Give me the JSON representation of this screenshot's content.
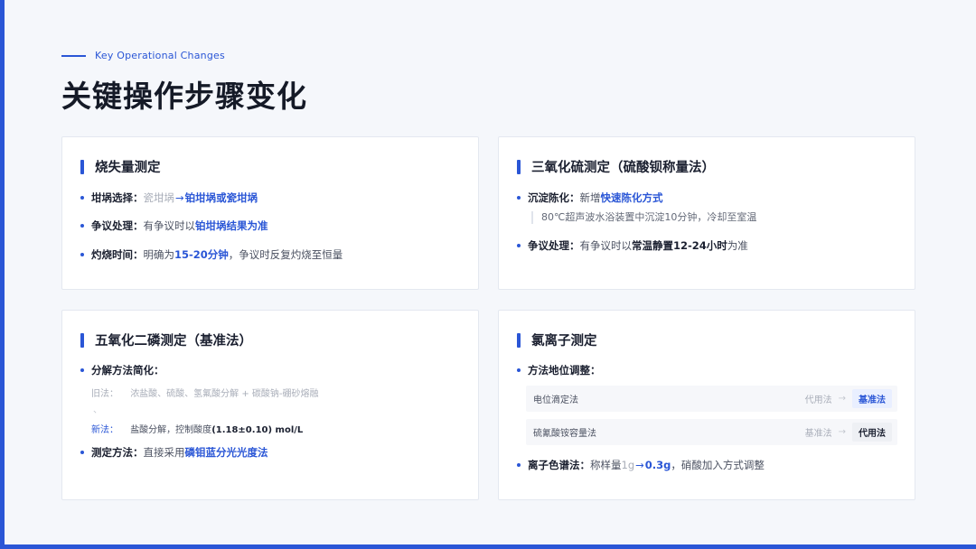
{
  "header": {
    "eyebrow": "Key Operational Changes",
    "title": "关键操作步骤变化"
  },
  "cards": [
    {
      "title": "烧失量测定",
      "items": [
        {
          "label": "坩埚选择：",
          "old": "瓷坩埚",
          "arrow": "→",
          "new": "铂坩埚或瓷坩埚"
        },
        {
          "label": "争议处理：",
          "text": "有争议时以",
          "highlight": "铂坩埚结果为准"
        },
        {
          "label": "灼烧时间：",
          "text": "明确为",
          "highlight": "15-20分钟",
          "tail": "，争议时反复灼烧至恒量"
        }
      ]
    },
    {
      "title": "三氧化硫测定（硫酸钡称量法）",
      "items": [
        {
          "label": "沉淀陈化：",
          "text": "新增 ",
          "highlight": "快速陈化方式",
          "note": "80℃超声波水浴装置中沉淀10分钟，冷却至室温"
        },
        {
          "label": "争议处理：",
          "text": "有争议时以",
          "strong": "常温静置12-24小时",
          "tail": "为准"
        }
      ]
    },
    {
      "title": "五氧化二磷测定（基准法）",
      "items": [
        {
          "label": "分解方法简化："
        },
        {
          "label": "测定方法：",
          "text": "直接采用",
          "highlight": "磷钼蓝分光光度法"
        }
      ],
      "old_method": {
        "key": "旧法：",
        "value": "浓盐酸、硫酸、氢氟酸分解 + 碳酸钠-硼砂熔融",
        "tick": "、"
      },
      "new_method": {
        "key": "新法：",
        "value": "盐酸分解，控制酸度",
        "bold": "(1.18±0.10) mol/L"
      }
    },
    {
      "title": "氯离子测定",
      "items": [
        {
          "label": "方法地位调整："
        },
        {
          "label": "离子色谱法：",
          "text": "称样量",
          "old": "1g",
          "arrow": "→",
          "highlight": "0.3g",
          "tail": "，硝酸加入方式调整"
        }
      ],
      "methods": [
        {
          "name": "电位滴定法",
          "from": "代用法",
          "arrow": "→",
          "to": "基准法"
        },
        {
          "name": "硫氰酸铵容量法",
          "from": "基准法",
          "arrow": "→",
          "to": "代用法"
        }
      ]
    }
  ],
  "colors": {
    "accent": "#2a56d6",
    "background": "#f5f7fb",
    "card": "#ffffff",
    "muted": "#a9aeb9"
  }
}
